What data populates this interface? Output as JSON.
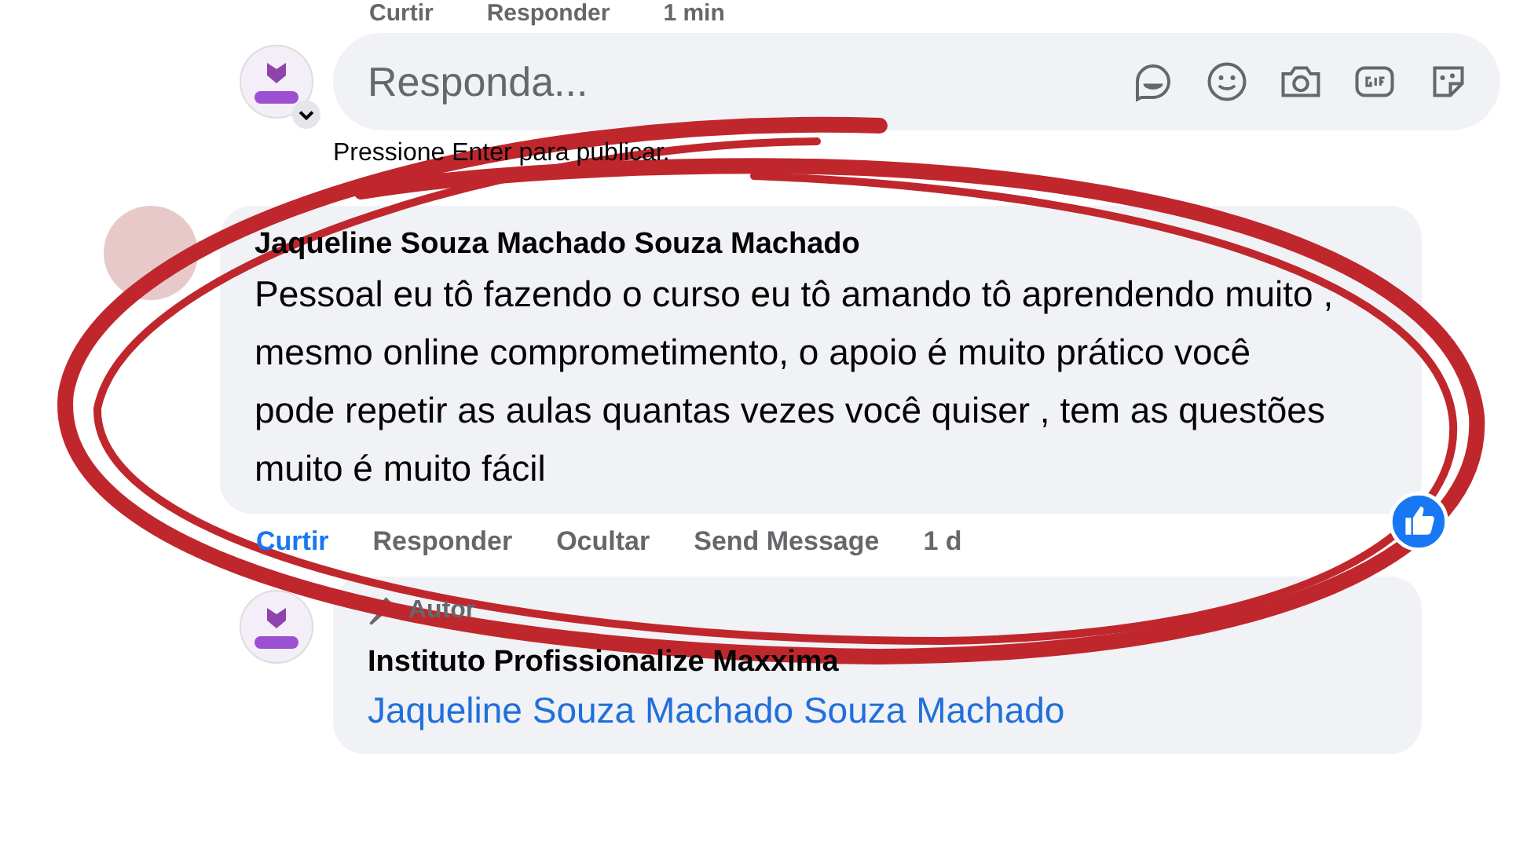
{
  "previous_actions": [
    "Curtir",
    "Responder",
    "1 min"
  ],
  "reply_box": {
    "placeholder": "Responda...",
    "hint": "Pressione Enter para publicar."
  },
  "comment": {
    "author": "Jaqueline Souza Machado Souza Machado",
    "text": "Pessoal eu tô fazendo o curso eu tô amando tô aprendendo muito , mesmo online comprometimento, o apoio é muito prático você pode repetir as aulas quantas vezes você quiser , tem as questões muito é muito fácil",
    "liked": true,
    "actions": [
      {
        "label": "Curtir",
        "selected": true
      },
      {
        "label": "Responder",
        "selected": false
      },
      {
        "label": "Ocultar",
        "selected": false
      },
      {
        "label": "Send Message",
        "selected": false
      },
      {
        "label": "1 d",
        "selected": false
      }
    ]
  },
  "reply": {
    "badge": "Autor",
    "author": "Instituto Profissionalize Maxxima",
    "mention": "Jaqueline Souza Machado Souza Machado"
  }
}
